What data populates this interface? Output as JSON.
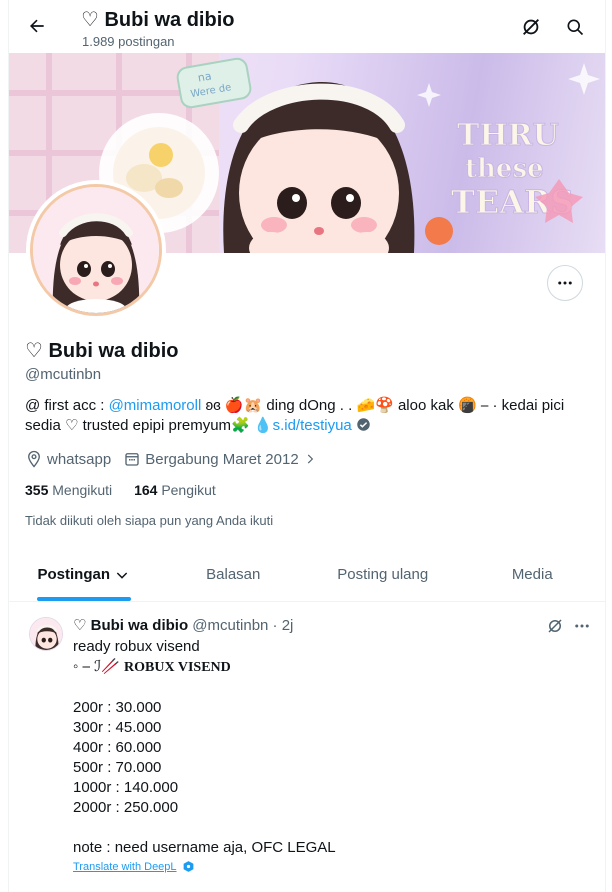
{
  "header": {
    "title": "♡ Bubi wa dibio",
    "post_count": "1.989 postingan"
  },
  "banner": {
    "lettering": [
      "THRU",
      "these",
      "TEARS"
    ],
    "note_text": "Were de"
  },
  "profile": {
    "name": "♡ Bubi wa dibio",
    "handle": "@mcutinbn",
    "bio_prefix": "@ first acc : ",
    "bio_mention": "@mimamoroll",
    "bio_middle": " ʚɞ 🍎🐹 ding dOng . . 🧀🍄 aloo kak 🍘 ⎯ · kedai pici sedia ♡  trusted epipi premyum🧩 💧",
    "bio_link": "s.id/testiyua",
    "location": "whatsapp",
    "joined": "Bergabung Maret 2012",
    "following_count": "355",
    "following_label": "Mengikuti",
    "followers_count": "164",
    "followers_label": "Pengikut",
    "followers_note": "Tidak diikuti oleh siapa pun yang Anda ikuti"
  },
  "tabs": [
    {
      "label": "Postingan",
      "active": true
    },
    {
      "label": "Balasan",
      "active": false
    },
    {
      "label": "Posting ulang",
      "active": false
    },
    {
      "label": "Media",
      "active": false
    }
  ],
  "post": {
    "name": "♡ Bubi wa dibio",
    "handle": "@mcutinbn",
    "separator": "·",
    "time": "2j",
    "line1": "ready robux visend",
    "line2_prefix": "◦ ⎯ ℐ🥢 ",
    "line2_title": "ROBUX VISEND",
    "prices": [
      "200r : 30.000",
      "300r : 45.000",
      "400r : 60.000",
      "500r : 70.000",
      "1000r : 140.000",
      "2000r : 250.000"
    ],
    "note": "note : need username aja, OFC LEGAL",
    "translate": "Translate with DeepL"
  },
  "icons": {
    "back": "arrow-left-icon",
    "grok": "grok-icon",
    "search": "search-icon",
    "more": "more-dots-icon",
    "location": "location-pin-icon",
    "calendar": "calendar-icon",
    "verified": "verified-check-icon",
    "deepl": "deepl-icon"
  },
  "colors": {
    "accent": "#1d9bf0",
    "text": "#0f1419",
    "muted": "#536471",
    "verified_green": "#00ba7c"
  }
}
